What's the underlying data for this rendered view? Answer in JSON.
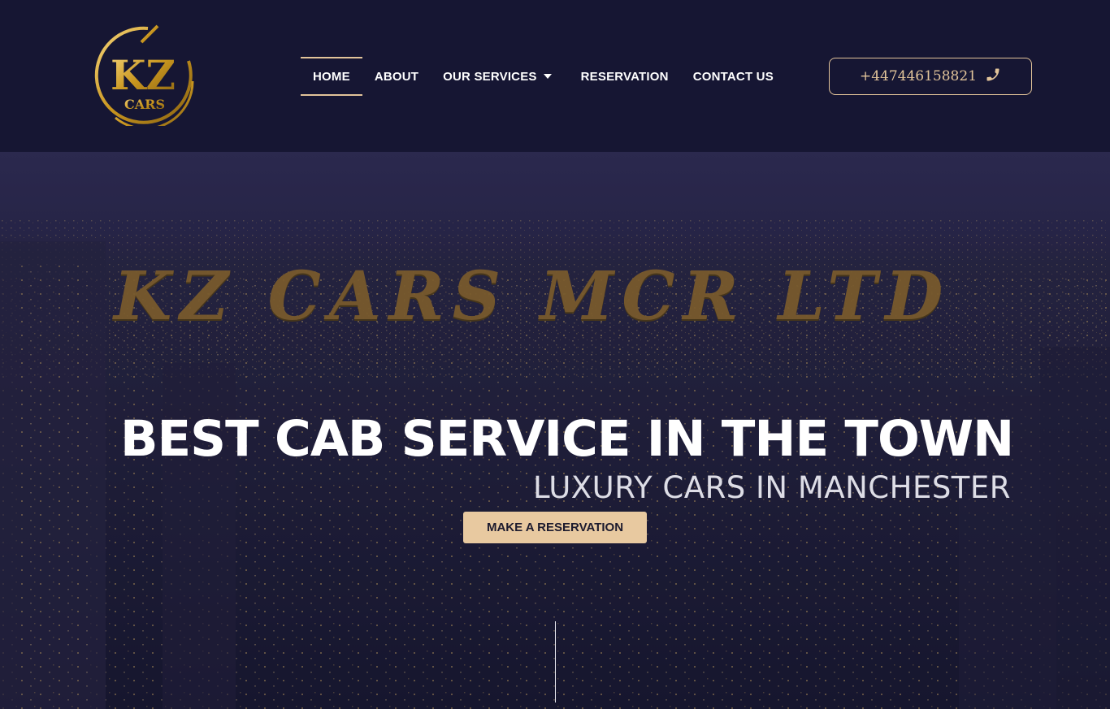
{
  "header": {
    "logo": {
      "big_text": "KZ",
      "small_text": "CARS",
      "gold": "#d4a63a"
    },
    "nav": [
      {
        "label": "HOME",
        "active": true
      },
      {
        "label": "ABOUT",
        "active": false
      },
      {
        "label": "OUR SERVICES",
        "active": false,
        "has_dropdown": true
      },
      {
        "label": "RESERVATION",
        "active": false
      },
      {
        "label": "CONTACT US",
        "active": false
      }
    ],
    "phone": {
      "number": "+447446158821",
      "icon": "phone-icon"
    }
  },
  "hero": {
    "brand_title": "KZ CARS MCR LTD",
    "headline": "BEST CAB SERVICE IN THE TOWN",
    "subline": "LUXURY CARS IN MANCHESTER",
    "cta_label": "MAKE A RESERVATION"
  },
  "colors": {
    "header_bg": "#161633",
    "accent": "#e2c49a",
    "cta_bg": "#e8c9a0",
    "brand_title": "#7a5b2c"
  }
}
